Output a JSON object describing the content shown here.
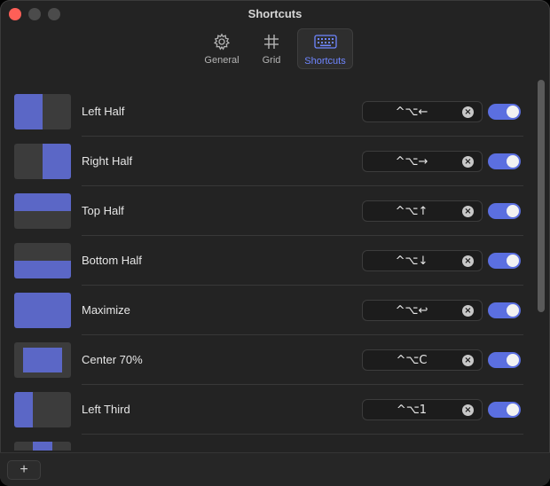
{
  "window": {
    "title": "Shortcuts"
  },
  "tabs": [
    {
      "label": "General",
      "icon": "gear-icon"
    },
    {
      "label": "Grid",
      "icon": "grid-icon"
    },
    {
      "label": "Shortcuts",
      "icon": "keyboard-icon",
      "selected": true
    }
  ],
  "colors": {
    "accent": "#6f86ff",
    "toggle_on": "#5b6fe0",
    "thumb_fill": "#5b67c6"
  },
  "shortcuts": [
    {
      "label": "Left Half",
      "keys": "^⌥←",
      "enabled": true
    },
    {
      "label": "Right Half",
      "keys": "^⌥→",
      "enabled": true
    },
    {
      "label": "Top Half",
      "keys": "^⌥↑",
      "enabled": true
    },
    {
      "label": "Bottom Half",
      "keys": "^⌥↓",
      "enabled": true
    },
    {
      "label": "Maximize",
      "keys": "^⌥↩",
      "enabled": true
    },
    {
      "label": "Center 70%",
      "keys": "^⌥C",
      "enabled": true
    },
    {
      "label": "Left Third",
      "keys": "^⌥1",
      "enabled": true
    }
  ],
  "footer": {
    "add_label": "+"
  }
}
